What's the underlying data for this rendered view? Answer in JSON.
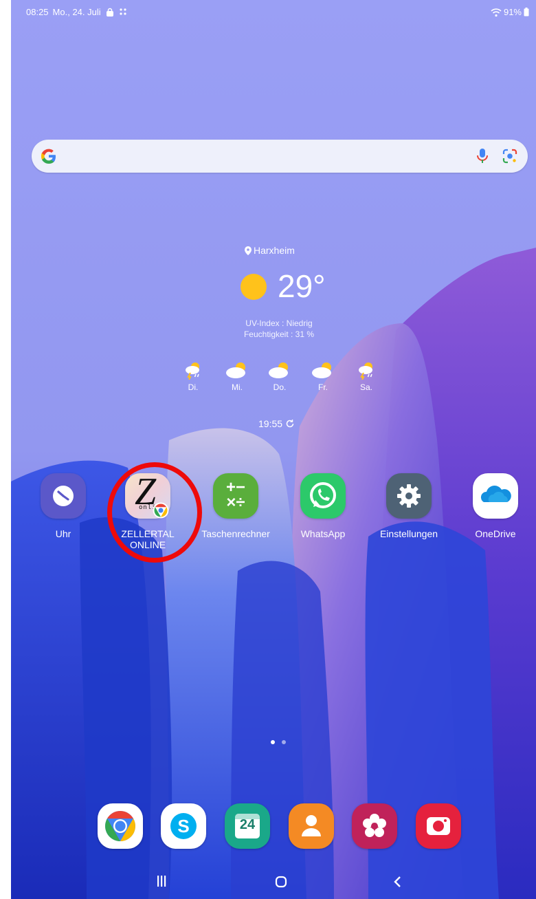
{
  "status_bar": {
    "time": "08:25",
    "date": "Mo., 24. Juli",
    "battery": "91%"
  },
  "search_bar": {
    "google_letter": "G"
  },
  "weather": {
    "location": "Harxheim",
    "temperature": "29°",
    "uv_index": "UV-Index : Niedrig",
    "humidity": "Feuchtigkeit : 31 %",
    "forecast": [
      {
        "day": "Di.",
        "icon": "thunderstorm-icon"
      },
      {
        "day": "Mi.",
        "icon": "partly-cloudy-icon"
      },
      {
        "day": "Do.",
        "icon": "partly-cloudy-icon"
      },
      {
        "day": "Fr.",
        "icon": "partly-cloudy-icon"
      },
      {
        "day": "Sa.",
        "icon": "thunderstorm-icon"
      }
    ],
    "last_update": "19:55"
  },
  "apps": [
    {
      "label": "Uhr",
      "icon": "clock-icon",
      "color": "#5b58c9"
    },
    {
      "label": "ZELLERTAL ONLINE",
      "icon": "zellertal-icon",
      "logo_text": "Z",
      "logo_sub": "onli",
      "color": "#f2d9cf"
    },
    {
      "label": "Taschenrechner",
      "icon": "calculator-icon",
      "calc_top": "+−",
      "calc_bottom": "×÷",
      "color": "#5aae3c"
    },
    {
      "label": "WhatsApp",
      "icon": "whatsapp-icon",
      "color": "#2cc96a"
    },
    {
      "label": "Einstellungen",
      "icon": "settings-icon",
      "color": "#4e6275"
    },
    {
      "label": "OneDrive",
      "icon": "onedrive-icon",
      "color": "#ffffff"
    }
  ],
  "dock": {
    "chrome": "chrome-icon",
    "skype": "skype-icon",
    "skype_letter": "S",
    "calendar": "calendar-icon",
    "calendar_day": "24",
    "contacts": "contacts-icon",
    "gallery": "gallery-icon",
    "camera": "camera-icon"
  },
  "colors": {
    "wallpaper_top": "#979cf3",
    "highlight": "#ee0a0a"
  }
}
